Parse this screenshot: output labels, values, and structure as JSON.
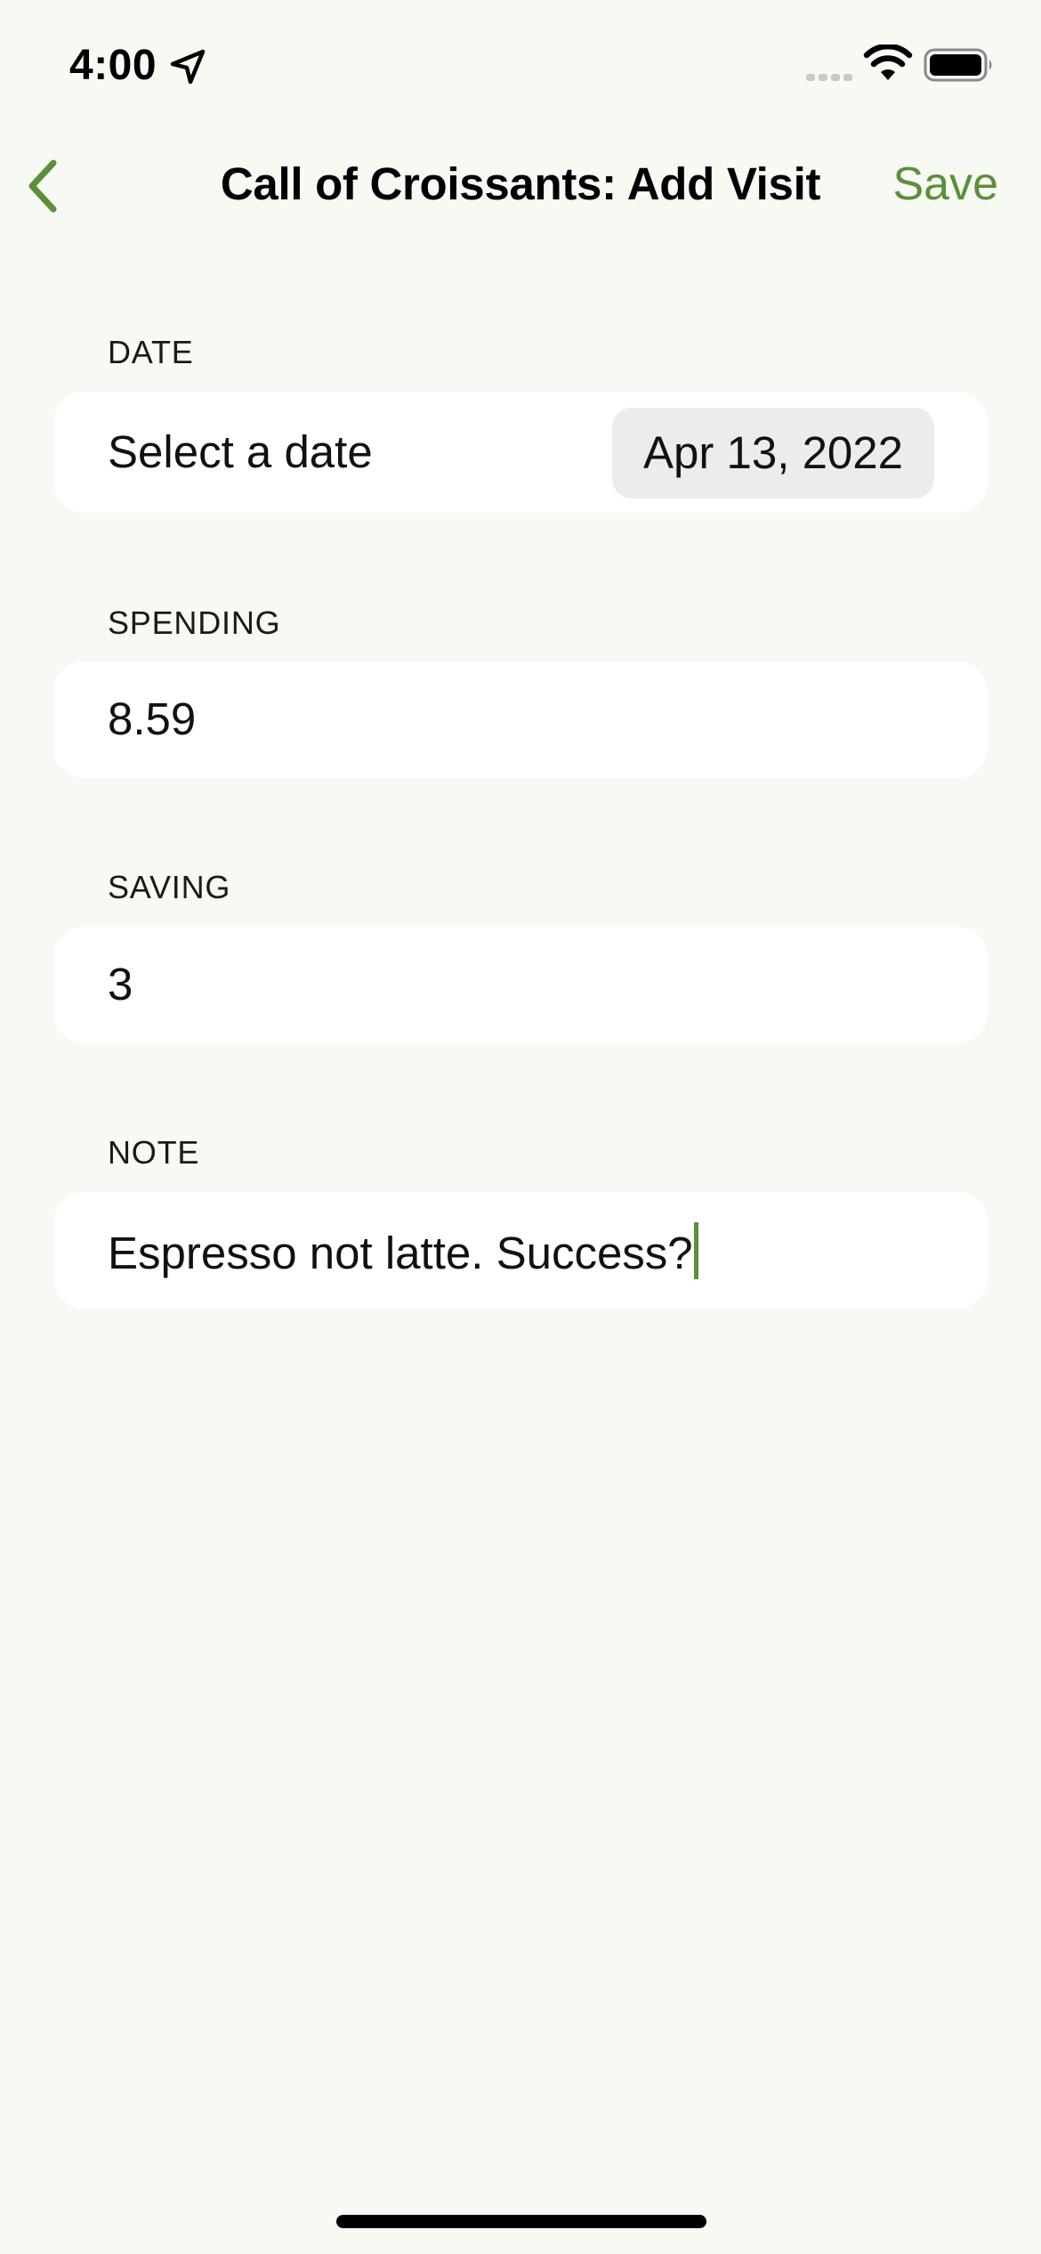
{
  "status_bar": {
    "time": "4:00"
  },
  "nav": {
    "title": "Call of Croissants: Add Visit",
    "save_label": "Save",
    "accent_color": "#5b8f3a"
  },
  "form": {
    "date": {
      "header": "DATE",
      "label": "Select a date",
      "value": "Apr 13, 2022"
    },
    "spending": {
      "header": "SPENDING",
      "value": "8.59"
    },
    "saving": {
      "header": "SAVING",
      "value": "3"
    },
    "note": {
      "header": "NOTE",
      "value": "Espresso not latte. Success?"
    }
  },
  "icons": {
    "back": "chevron-left-icon",
    "location": "location-arrow-icon",
    "signal": "cellular-signal-icon",
    "wifi": "wifi-icon",
    "battery": "battery-icon"
  }
}
